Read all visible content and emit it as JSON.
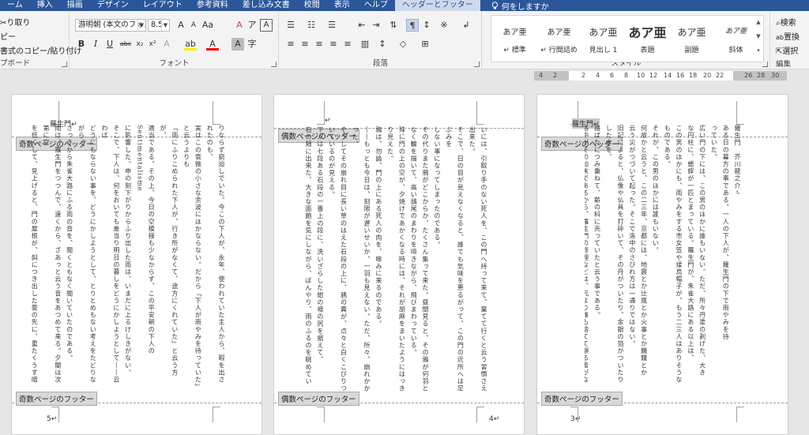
{
  "tabs": [
    {
      "label": "ーム"
    },
    {
      "label": "挿入"
    },
    {
      "label": "描画"
    },
    {
      "label": "デザイン"
    },
    {
      "label": "レイアウト"
    },
    {
      "label": "参考資料"
    },
    {
      "label": "差し込み文書"
    },
    {
      "label": "校閲"
    },
    {
      "label": "表示"
    },
    {
      "label": "ヘルプ"
    },
    {
      "label": "ヘッダーとフッター"
    }
  ],
  "tellme": "何をしますか",
  "clipboard": {
    "cut": "り取り",
    "copy": "ピー",
    "format_painter": "書式のコピー/貼り付け",
    "label": "プボード"
  },
  "font": {
    "name": "游明朝 (本文のフォン",
    "size": "8.5",
    "label": "フォント"
  },
  "paragraph": {
    "label": "段落"
  },
  "styles": {
    "label": "スタイル",
    "items": [
      {
        "sample": "あア亜",
        "name": "標準",
        "mark": "↵"
      },
      {
        "sample": "あア亜",
        "name": "行間詰め",
        "mark": "↵"
      },
      {
        "sample": "あア亜",
        "name": "見出し 1",
        "mark": ""
      },
      {
        "sample": "あア亜",
        "name": "表題",
        "mark": ""
      },
      {
        "sample": "あア亜",
        "name": "副題",
        "mark": ""
      },
      {
        "sample": "あア亜",
        "name": "斜体",
        "mark": ""
      }
    ]
  },
  "editing": {
    "find": "検索",
    "replace": "置換",
    "select": "選択",
    "label": "編集"
  },
  "ruler": {
    "numbers": [
      "4",
      "2",
      "2",
      "4",
      "6",
      "8",
      "10",
      "12",
      "14",
      "16",
      "18",
      "20",
      "22",
      "26",
      "28",
      "30"
    ]
  },
  "pages": [
    {
      "header_tag": "奇数ページのヘッダー",
      "footer_tag": "奇数ページのフッター",
      "header_text": "羅生門↵",
      "page_number": "5↵",
      "lines": [
        "りならず窮迫しでいた。今この下人が、永年、使われていた主人から、暇を出されたのも、",
        "実はこの衰微の小さな余波にほかならない。だから「下人が雨やみを待っていた」と云うよりも",
        "「雨にふりこめられた下人が、行き所がなくて、途方にくれていた」と云う方が、",
        "適当である。その上、今日の空模様も少なからず、この平安朝の下人のSentimentalisme",
        "に影響した。申の刻下がりからふり出した雨は、いまだに上るけしきがない。",
        "そこで、下人は、何をおいても差当り明日の暮しをどうにかしようとして――云わば",
        "どうにもならない事を、どうにかしようとして、とりとめもない考えをたどりながら、",
        "さっきから朱雀大路にふる雨の音を、聞くともなく聞いていたのである。",
        "雨は、羅生門をつつんで、遠くから、ざあっと云う音をあつめて来る。夕闇は次第に空",
        "を低くして、見上げると、門の屋根が、斜につき出した甍の先に、重たくうす暗い",
        "雲を支えている。",
        "どうにもならない事を、どうにかするためには、手段を選んでいる遑はない。",
        "選んでいれば、築土の下か、道ばたの土の上で、饑死をするばかりである。",
        "そうして、この門の上へ持って来て、犬のように棄てられてしまうばかりである。",
        "選ばないとすれば――下人の考えは、何度も同じ道を低徊した揚句に、",
        "やっとこの局所へ逢着した。"
      ]
    },
    {
      "header_tag": "偶数ページのヘッダー",
      "footer_tag": "偶数ページのフッター",
      "header_text": "↵",
      "page_number": "4↵",
      "lines": [
        "いには、引取り手のない死人を、この門へ持って来て、棄てて行くと云う習慣さえ出来た。",
        "そこで、日の目が見えなくなると、誰でも気味を悪るがって、この門の近所へは足ぶみを",
        "しない事になってしまったのである。",
        "その代りまた鴉がどこからか、たくさん集って来た。昼間見ると、その鴉が何羽と",
        "なく輪を描いて、高い鴟尾のまわりを啼きながら、飛びまわっている。",
        "殊に門の上の空が、夕焼けであかくなる時には、それが胡麻をまいたようにはっきり見えた。",
        "鴉は、勿論、門の上にある死人の肉を、啄みに来るのである。",
        "――もっとも今日は、刻限が遅いせいか、一羽も見えない。ただ、所々、崩れかかった、",
        "そうしてその崩れ目に長い草のはえた石段の上に、鴉の糞が、点々と白くこびりついているのが見える。",
        "下人は七段ある石段の一番上の段に、洗いざらした紺の襖の尻を据えて、",
        "右の頬に出来た、大きな面皰を気にしながら、ぼんやり、雨のふるのを眺めていた。",
        "作者はさっき、「下人が雨やみを待っていた」と書いた。しかし、下人は雨がやんでも、",
        "格別どうしようと云う当てはない。ふだんなら、勿論、主人の家へ帰る可き筈である。",
        "所がその主人からは、四五日前に暇を出された。前にも書いたように、当時京都の町は",
        "一通りならず衰微していた。"
      ]
    },
    {
      "header_tag": "奇数ページのヘッダー",
      "footer_tag": "奇数ページのフッター",
      "header_text": "羅生門↵",
      "page_number": "3↵",
      "lines": [
        "羅生門　芥川龍之介↵",
        "ある日の暮方の事である。一人の下人が、羅生門の下で雨やみを待",
        "っていた。",
        "広い門の下には、この男のほかに誰もいない。ただ、所々丹塗の剥げた、大き",
        "な円柱に、蟋蟀が一匹とまっている。羅生門が、朱雀大路にある以上は、",
        "この男のほかにも、雨やみをする市女笠や揉烏帽子が、もう二三人はありそうなものである。",
        "それが、この男のほかには誰もいない。",
        "何故かと云うと、この二三年、京都には、地震とか辻風とか火事とか饑饉とか",
        "云う災がつづいて起った。そこで洛中のさびれ方は一通りではない。",
        "旧記によると、仏像や仏具を打砕いて、その丹がついたり、金銀の箔がついたりした木を、",
        "路ばたにつみ重ねて、薪の料に売っていたと云う事である。",
        "洛中がその始末であるから、羅生門の修理などは、元より誰も捨てて顧る者がなかった。",
        "するとその荒れ果てたのをよい事にして、狐狸が棲む。盗人が棲む。とうとうし"
      ]
    }
  ]
}
